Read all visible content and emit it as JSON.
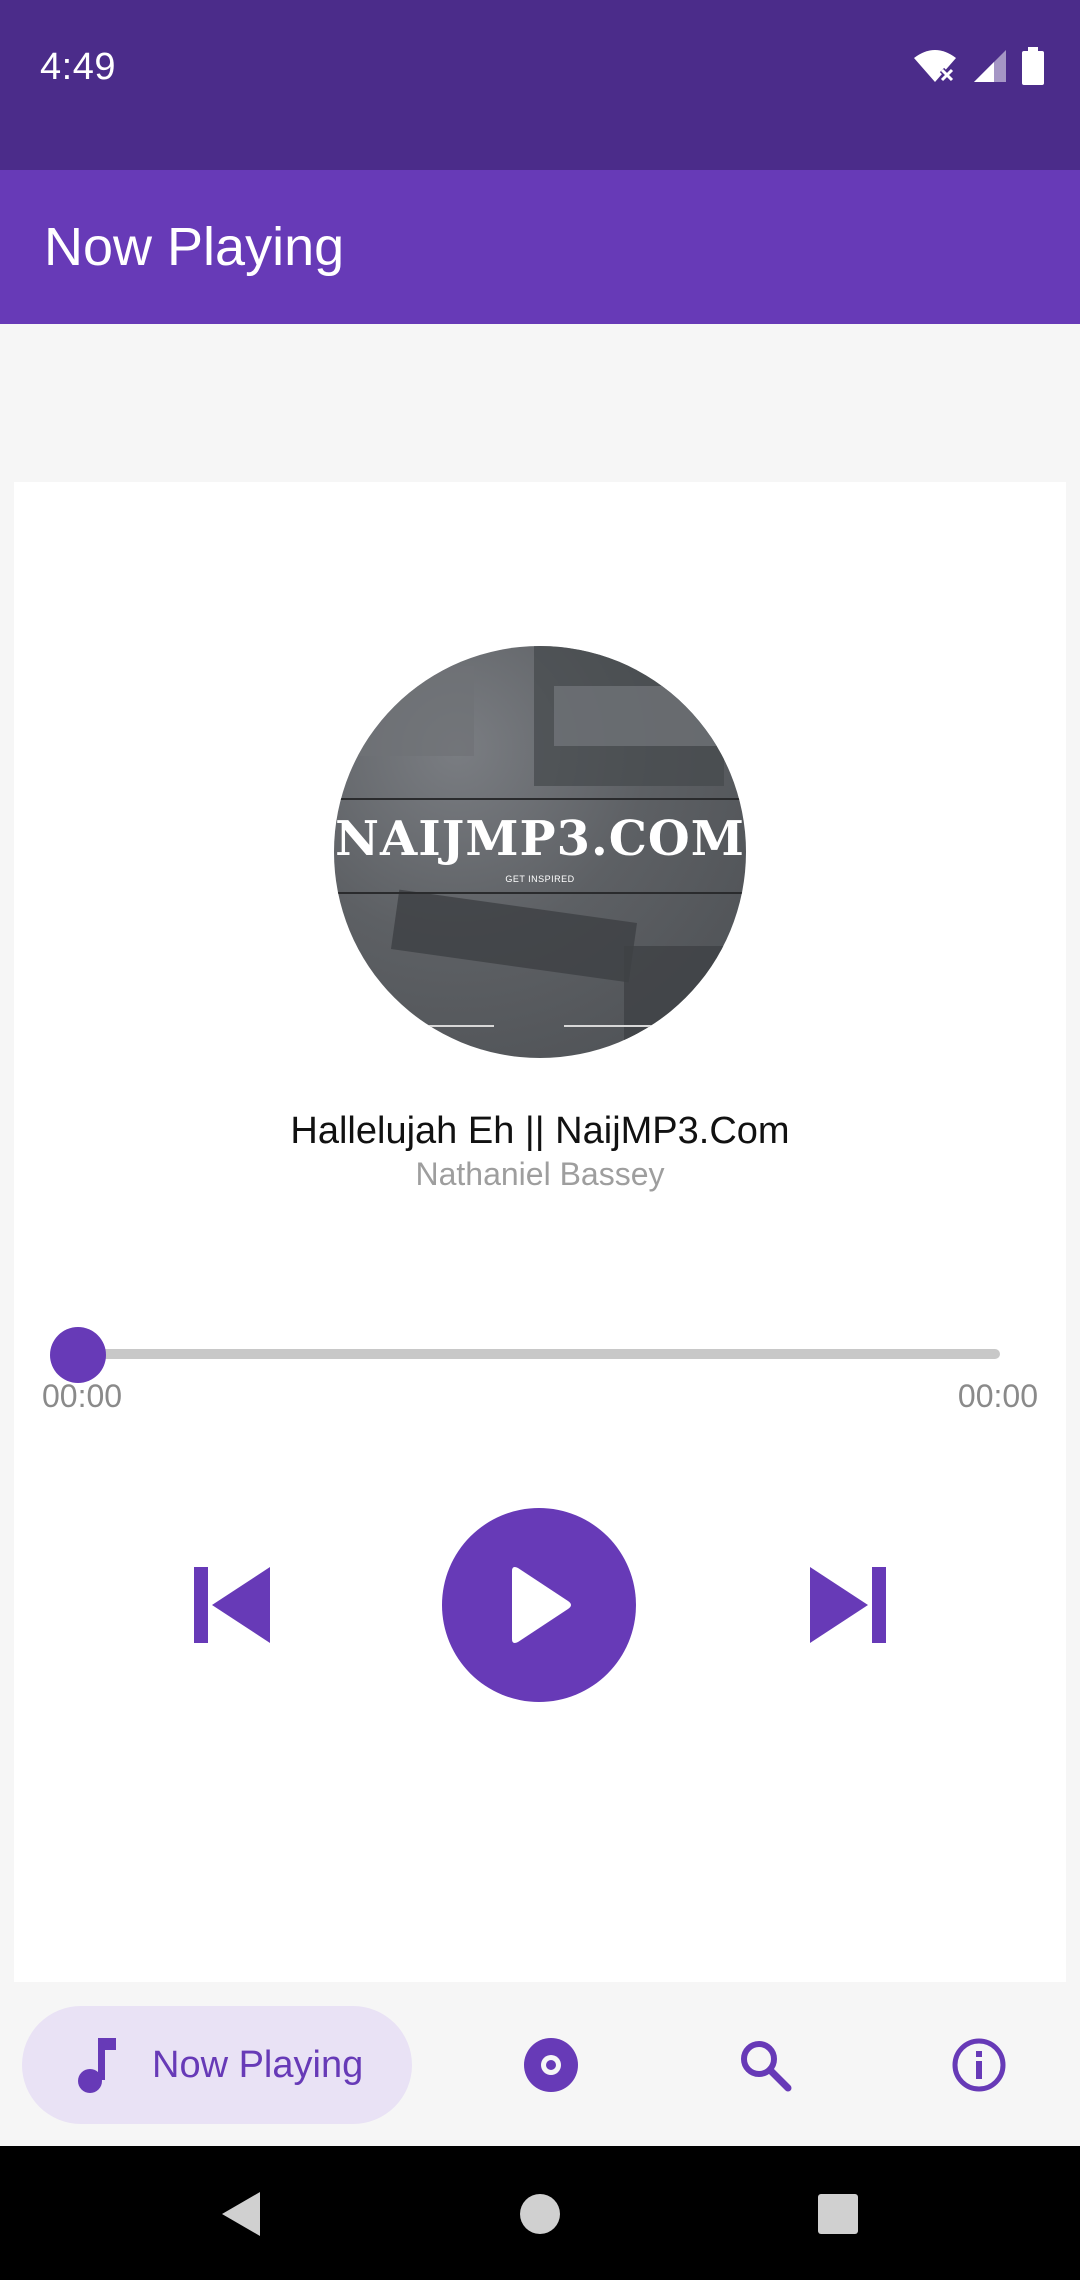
{
  "status_bar": {
    "time": "4:49",
    "icons": [
      "wifi-off-icon",
      "cell-signal-icon",
      "battery-icon"
    ]
  },
  "app_bar": {
    "title": "Now Playing"
  },
  "player": {
    "album_art": {
      "logo_text": "NAIJMP3.COM",
      "tagline": "GET INSPIRED"
    },
    "song_title": "Hallelujah Eh || NaijMP3.Com",
    "artist": "Nathaniel Bassey",
    "progress_fraction": 0,
    "time_current": "00:00",
    "time_total": "00:00",
    "controls": [
      "skip-previous-icon",
      "play-icon",
      "skip-next-icon"
    ]
  },
  "bottom_nav": {
    "items": [
      {
        "label": "Now Playing",
        "icon": "music-note-icon",
        "active": true
      },
      {
        "icon": "album-disc-icon",
        "active": false
      },
      {
        "icon": "search-icon",
        "active": false
      },
      {
        "icon": "info-icon",
        "active": false
      }
    ]
  },
  "colors": {
    "status_bar": "#4b2c8a",
    "primary": "#673ab7",
    "active_pill": "#e9e2f5",
    "track": "#c8c8c8"
  }
}
